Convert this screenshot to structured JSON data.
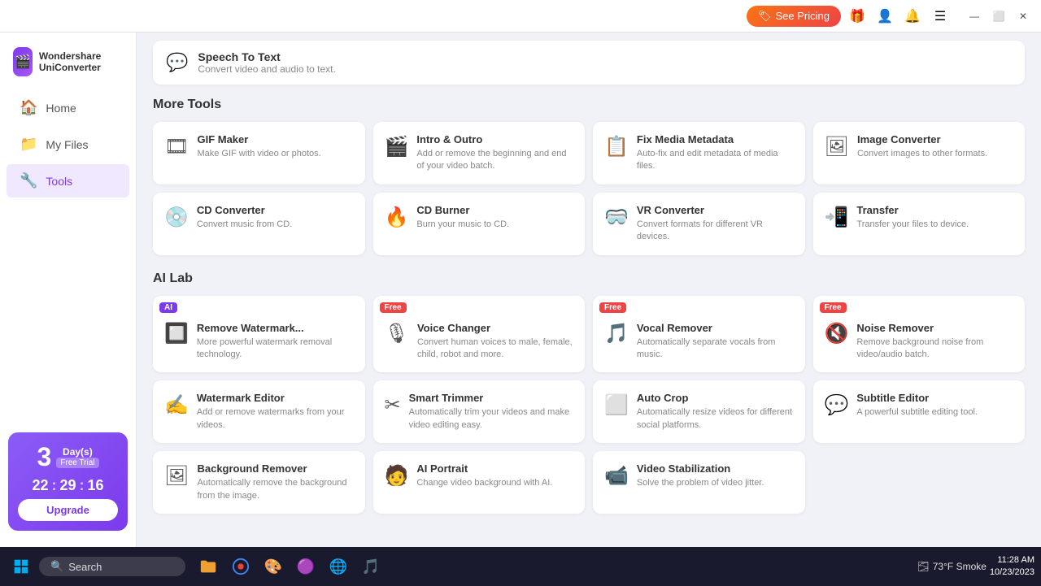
{
  "app": {
    "name": "Wondershare UniConverter",
    "logo_emoji": "🎬"
  },
  "titlebar": {
    "see_pricing": "See Pricing",
    "min": "—",
    "max": "⬜",
    "close": "✕"
  },
  "nav": {
    "items": [
      {
        "id": "home",
        "label": "Home",
        "icon": "🏠",
        "active": false
      },
      {
        "id": "my-files",
        "label": "My Files",
        "icon": "📁",
        "active": false
      },
      {
        "id": "tools",
        "label": "Tools",
        "icon": "🔧",
        "active": true
      }
    ]
  },
  "trial": {
    "days": "3",
    "days_label": "Day(s)",
    "free_trial": "Free Trial",
    "hours": "22",
    "minutes": "29",
    "seconds": "16",
    "upgrade_label": "Upgrade"
  },
  "top_tool": {
    "icon": "💬",
    "title": "Speech To Text",
    "desc": "Convert video and audio to text."
  },
  "more_tools": {
    "section_title": "More Tools",
    "items": [
      {
        "id": "gif-maker",
        "icon": "🎞",
        "title": "GIF Maker",
        "desc": "Make GIF with video or photos.",
        "badge": null
      },
      {
        "id": "intro-outro",
        "icon": "🎬",
        "title": "Intro & Outro",
        "desc": "Add or remove the beginning and end of your video batch.",
        "badge": null
      },
      {
        "id": "fix-media-metadata",
        "icon": "📋",
        "title": "Fix Media Metadata",
        "desc": "Auto-fix and edit metadata of media files.",
        "badge": null
      },
      {
        "id": "image-converter",
        "icon": "🖼",
        "title": "Image Converter",
        "desc": "Convert images to other formats.",
        "badge": null
      },
      {
        "id": "cd-converter",
        "icon": "💿",
        "title": "CD Converter",
        "desc": "Convert music from CD.",
        "badge": null
      },
      {
        "id": "cd-burner",
        "icon": "🔥",
        "title": "CD Burner",
        "desc": "Burn your music to CD.",
        "badge": null
      },
      {
        "id": "vr-converter",
        "icon": "🥽",
        "title": "VR Converter",
        "desc": "Convert formats for different VR devices.",
        "badge": null
      },
      {
        "id": "transfer",
        "icon": "📲",
        "title": "Transfer",
        "desc": "Transfer your files to device.",
        "badge": null
      }
    ]
  },
  "ai_lab": {
    "section_title": "AI Lab",
    "items": [
      {
        "id": "remove-watermark",
        "icon": "🔲",
        "title": "Remove Watermark...",
        "desc": "More powerful watermark removal technology.",
        "badge": "AI"
      },
      {
        "id": "voice-changer",
        "icon": "🎙",
        "title": "Voice Changer",
        "desc": "Convert human voices to male, female, child, robot and more.",
        "badge": "Free"
      },
      {
        "id": "vocal-remover",
        "icon": "🎵",
        "title": "Vocal Remover",
        "desc": "Automatically separate vocals from music.",
        "badge": "Free"
      },
      {
        "id": "noise-remover",
        "icon": "🔇",
        "title": "Noise Remover",
        "desc": "Remove background noise from video/audio batch.",
        "badge": "Free"
      },
      {
        "id": "watermark-editor",
        "icon": "✍",
        "title": "Watermark Editor",
        "desc": "Add or remove watermarks from your videos.",
        "badge": null
      },
      {
        "id": "smart-trimmer",
        "icon": "✂",
        "title": "Smart Trimmer",
        "desc": "Automatically trim your videos and make video editing easy.",
        "badge": null
      },
      {
        "id": "auto-crop",
        "icon": "⬜",
        "title": "Auto Crop",
        "desc": "Automatically resize videos for different social platforms.",
        "badge": null
      },
      {
        "id": "subtitle-editor",
        "icon": "💬",
        "title": "Subtitle Editor",
        "desc": "A powerful subtitle editing tool.",
        "badge": null
      },
      {
        "id": "background-remover",
        "icon": "🖼",
        "title": "Background Remover",
        "desc": "Automatically remove the background from the image.",
        "badge": null
      },
      {
        "id": "ai-portrait",
        "icon": "🧑",
        "title": "AI Portrait",
        "desc": "Change video background with AI.",
        "badge": null
      },
      {
        "id": "video-stabilization",
        "icon": "📹",
        "title": "Video Stabilization",
        "desc": "Solve the problem of video jitter.",
        "badge": null
      }
    ]
  },
  "taskbar": {
    "search_placeholder": "Search",
    "time": "11:28 AM",
    "date": "10/23/2023",
    "weather_temp": "73°F",
    "weather_condition": "Smoke"
  }
}
